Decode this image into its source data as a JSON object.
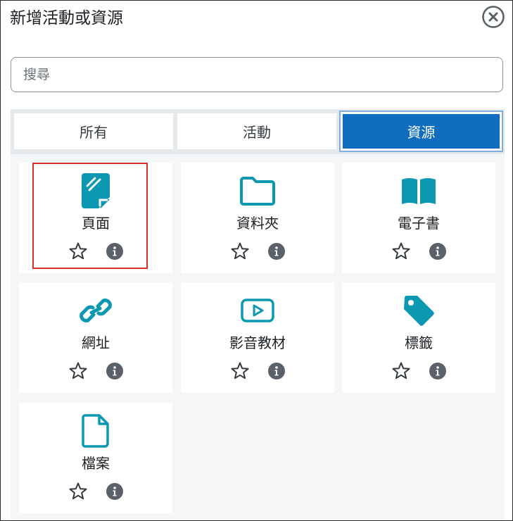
{
  "dialog": {
    "title": "新增活動或資源",
    "close_icon": "close-circle-icon"
  },
  "search": {
    "placeholder": "搜尋",
    "value": ""
  },
  "tabs": [
    {
      "label": "所有",
      "active": false
    },
    {
      "label": "活動",
      "active": false
    },
    {
      "label": "資源",
      "active": true
    }
  ],
  "colors": {
    "accent": "#0f6cbf",
    "icon_teal": "#0d98b2",
    "highlight_red": "#d9302a"
  },
  "modules": [
    {
      "name": "頁面",
      "icon": "page-icon",
      "highlighted": true
    },
    {
      "name": "資料夾",
      "icon": "folder-icon",
      "highlighted": false
    },
    {
      "name": "電子書",
      "icon": "book-icon",
      "highlighted": false
    },
    {
      "name": "網址",
      "icon": "link-icon",
      "highlighted": false
    },
    {
      "name": "影音教材",
      "icon": "video-icon",
      "highlighted": false
    },
    {
      "name": "標籤",
      "icon": "tag-icon",
      "highlighted": false
    },
    {
      "name": "檔案",
      "icon": "file-icon",
      "highlighted": false
    }
  ],
  "card_actions": {
    "star_icon": "star-outline-icon",
    "info_icon": "info-icon"
  }
}
